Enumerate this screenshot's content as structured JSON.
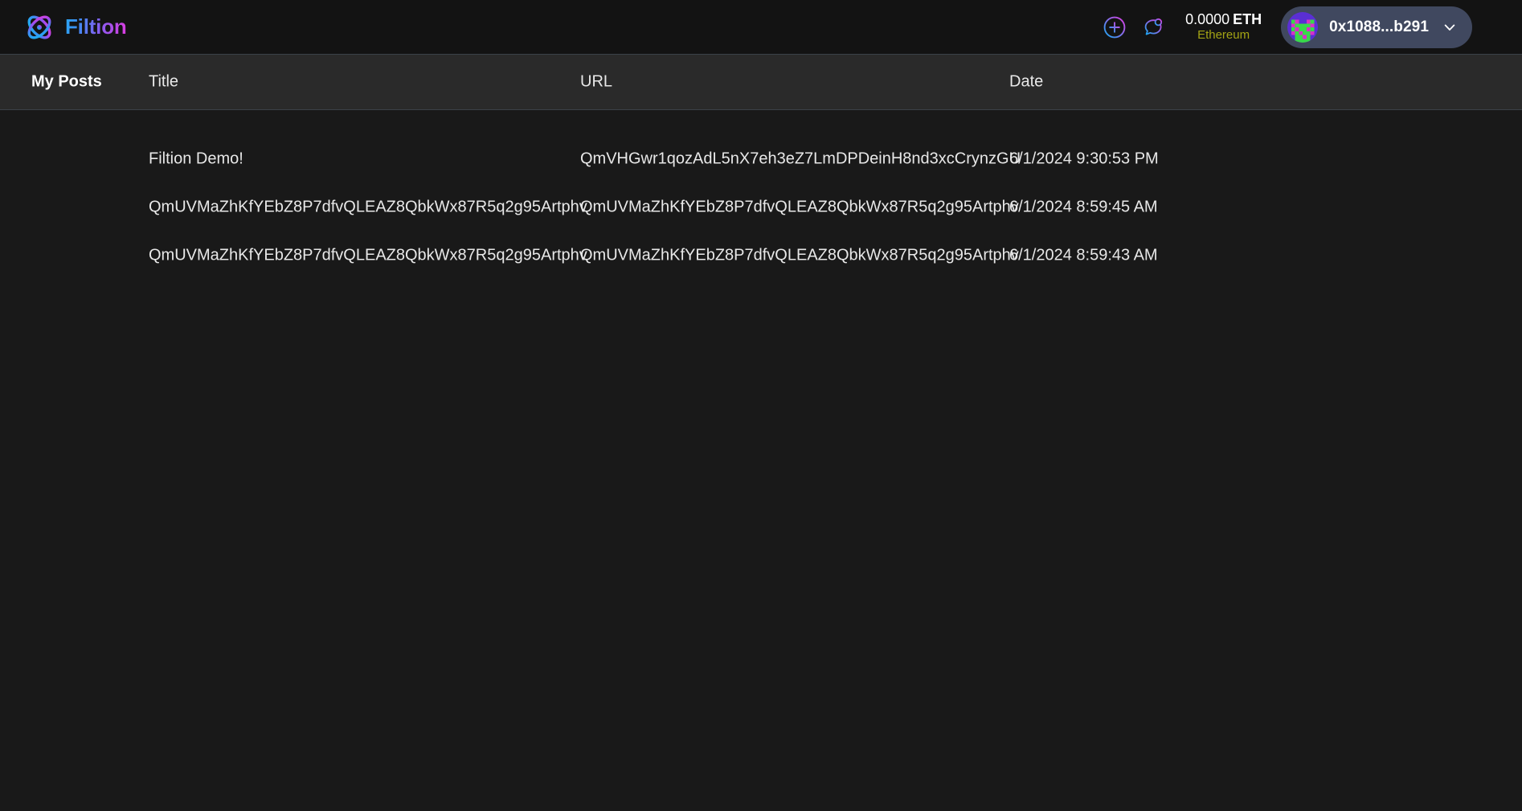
{
  "app": {
    "brand_name": "Filtion",
    "logo_icon": "atom-icon"
  },
  "topbar": {
    "add_icon": "plus-circle-icon",
    "chat_icon": "chat-bubble-icon",
    "balance": {
      "amount": "0.0000",
      "symbol": "ETH",
      "network": "Ethereum"
    },
    "account": {
      "avatar_icon": "blockie-avatar",
      "address": "0x1088...b291",
      "chevron_icon": "chevron-down-icon"
    }
  },
  "table": {
    "section_label": "My Posts",
    "columns": [
      "Title",
      "URL",
      "Date"
    ],
    "rows": [
      {
        "title": "Filtion Demo!",
        "url": "QmVHGwr1qozAdL5nX7eh3eZ7LmDPDeinH8nd3xcCrynzGU",
        "date": "6/1/2024 9:30:53 PM"
      },
      {
        "title": "QmUVMaZhKfYEbZ8P7dfvQLEAZ8QbkWx87R5q2g95Artphv",
        "url": "QmUVMaZhKfYEbZ8P7dfvQLEAZ8QbkWx87R5q2g95Artphv",
        "date": "6/1/2024 8:59:45 AM"
      },
      {
        "title": "QmUVMaZhKfYEbZ8P7dfvQLEAZ8QbkWx87R5q2g95Artphv",
        "url": "QmUVMaZhKfYEbZ8P7dfvQLEAZ8QbkWx87R5q2g95Artphv",
        "date": "6/1/2024 8:59:43 AM"
      }
    ]
  },
  "colors": {
    "page_bg": "#191919",
    "topbar_bg": "#131313",
    "header_band_bg": "#2a2a2a",
    "divider": "#3b4148",
    "accent_start": "#2aa9f5",
    "accent_end": "#e23ae0",
    "network_text": "#a3a314",
    "account_pill_bg": "#40485f"
  }
}
